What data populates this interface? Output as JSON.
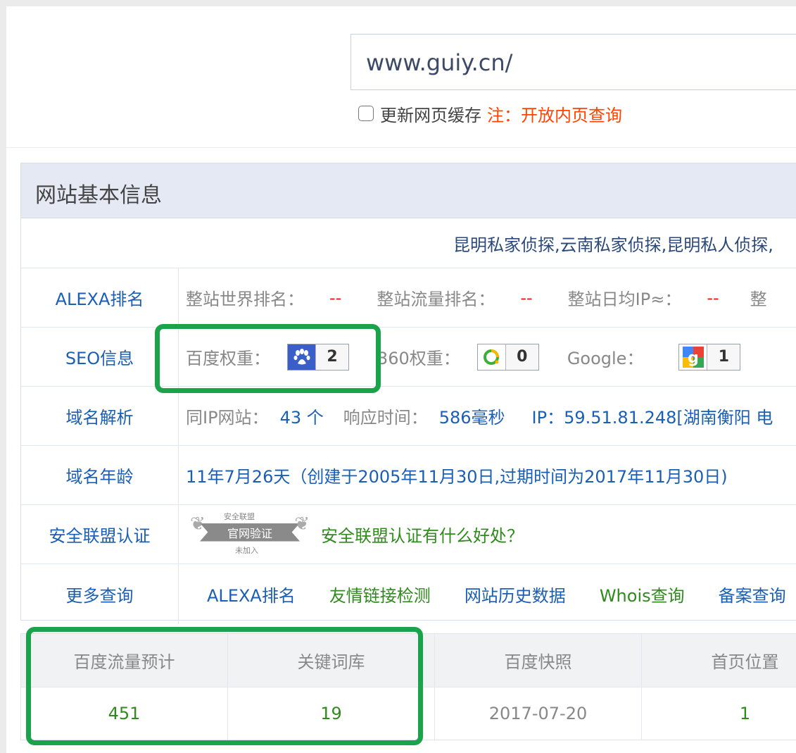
{
  "search": {
    "url": "www.guiy.cn/",
    "cache_label": "更新网页缓存",
    "cache_note": "注：开放内页查询"
  },
  "panel": {
    "title": "网站基本信息",
    "description": "昆明私家侦探,云南私家侦探,昆明私人侦探,",
    "alexa": {
      "label": "ALEXA排名",
      "world_rank_label": "整站世界排名：",
      "world_rank_value": "--",
      "traffic_rank_label": "整站流量排名：",
      "traffic_rank_value": "--",
      "daily_ip_label": "整站日均IP≈：",
      "daily_ip_value": "--",
      "cut_label": "整"
    },
    "seo": {
      "label": "SEO信息",
      "baidu_label": "百度权重：",
      "baidu_value": "2",
      "so360_label": "360权重：",
      "so360_value": "0",
      "google_label": "Google：",
      "google_value": "1"
    },
    "dns": {
      "label": "域名解析",
      "same_ip_label": "同IP网站：",
      "same_ip_value": "43 个",
      "response_label": "响应时间：",
      "response_value": "586毫秒",
      "ip_text": "IP：59.51.81.248[湖南衡阳 电"
    },
    "age": {
      "label": "域名年龄",
      "value": "11年7月26天（创建于2005年11月30日,过期时间为2017年11月30日)"
    },
    "security": {
      "label": "安全联盟认证",
      "seal_top": "安全联盟",
      "seal_band": "官网验证",
      "seal_bottom": "未加入",
      "link": "安全联盟认证有什么好处？"
    },
    "more": {
      "label": "更多查询",
      "links": [
        "ALEXA排名",
        "友情链接检测",
        "网站历史数据",
        "Whois查询",
        "备案查询"
      ]
    }
  },
  "stats": {
    "headers": [
      "百度流量预计",
      "关键词库",
      "百度快照",
      "首页位置"
    ],
    "values": [
      "451",
      "19",
      "2017-07-20",
      "1"
    ]
  },
  "colors": {
    "highlight": "#1aa34a",
    "link_blue": "#1a5fb4",
    "link_green": "#2e8b1c",
    "note_red": "#ff4400"
  }
}
